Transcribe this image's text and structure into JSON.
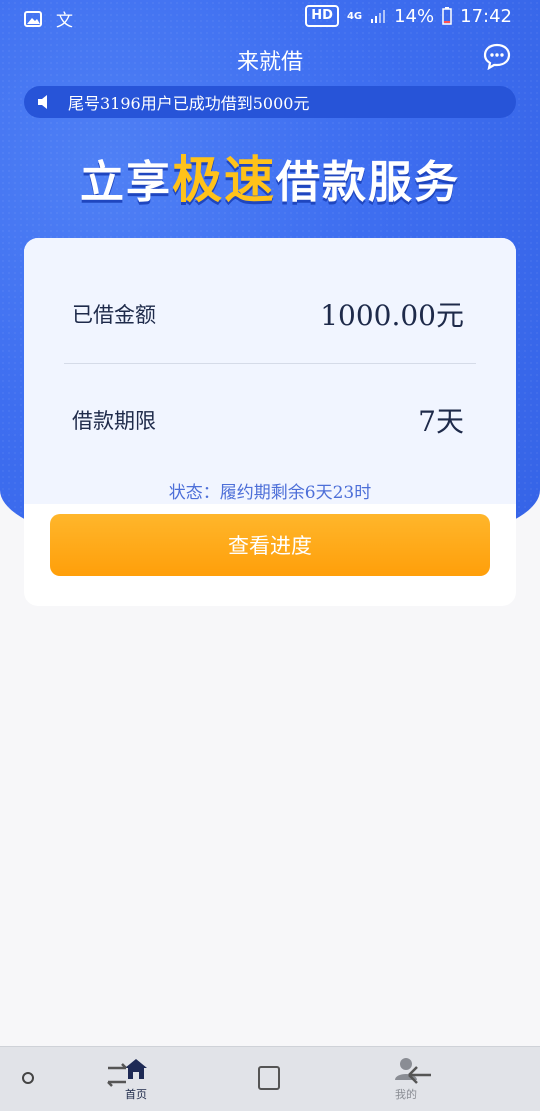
{
  "status_bar": {
    "hd": "HD",
    "network": "4G",
    "battery": "14%",
    "time": "17:42"
  },
  "header": {
    "title": "来就借"
  },
  "ticker": {
    "text": "尾号3196用户已成功借到5000元"
  },
  "slogan": {
    "part1": "立享",
    "highlight": "极速",
    "part2": "借款服务"
  },
  "loan_card": {
    "amount_label": "已借金额",
    "amount_value": "1000.00元",
    "term_label": "借款期限",
    "term_value": "7天",
    "status": "状态：履约期剩余6天23时",
    "button_label": "查看进度"
  },
  "bottom_nav": {
    "items": [
      {
        "label": "首页",
        "icon": "home-icon",
        "active": true
      },
      {
        "label": "我的",
        "icon": "user-icon",
        "active": false
      }
    ]
  },
  "colors": {
    "brand_blue": "#3e6ef0",
    "accent_orange": "#ffa41b",
    "slogan_highlight": "#ffc21a"
  }
}
